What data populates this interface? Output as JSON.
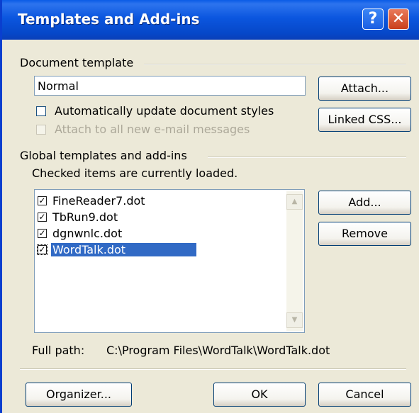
{
  "dialog": {
    "title": "Templates and Add-ins",
    "help_icon": "help-icon",
    "close_icon": "close-icon"
  },
  "document_template": {
    "group_label": "Document template",
    "value": "Normal",
    "attach_button": "Attach...",
    "linked_css_button": "Linked CSS...",
    "auto_update_label": "Automatically update document styles",
    "auto_update_checked": false,
    "attach_email_label": "Attach to all new e-mail messages",
    "attach_email_enabled": false
  },
  "global_templates": {
    "group_label": "Global templates and add-ins",
    "hint": "Checked items are currently loaded.",
    "items": [
      {
        "label": "FineReader7.dot",
        "checked": true
      },
      {
        "label": "TbRun9.dot",
        "checked": true
      },
      {
        "label": "dgnwnlc.dot",
        "checked": true
      },
      {
        "label": "WordTalk.dot",
        "checked": true,
        "selected": true
      }
    ],
    "add_button": "Add...",
    "remove_button": "Remove",
    "full_path_label": "Full path:",
    "full_path_value": "C:\\Program Files\\WordTalk\\WordTalk.dot"
  },
  "footer": {
    "organizer_button": "Organizer...",
    "ok_button": "OK",
    "cancel_button": "Cancel"
  },
  "colors": {
    "titlebar": "#0a5be6",
    "selection": "#316ac5",
    "dialog_bg": "#ece9d8"
  }
}
